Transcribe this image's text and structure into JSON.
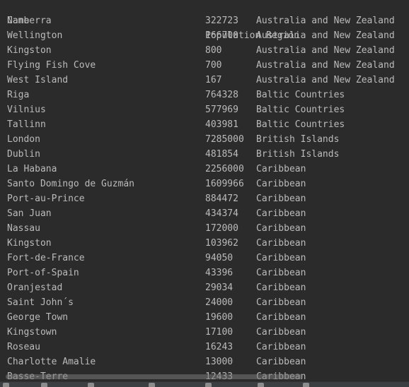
{
  "console": {
    "header": {
      "name": "Name",
      "population_region": "Population Region"
    },
    "rows": [
      {
        "name": "Canberra",
        "population": "322723",
        "region": "Australia and New Zealand"
      },
      {
        "name": "Wellington",
        "population": "166700",
        "region": "Australia and New Zealand"
      },
      {
        "name": "Kingston",
        "population": "800",
        "region": "Australia and New Zealand"
      },
      {
        "name": "Flying Fish Cove",
        "population": "700",
        "region": "Australia and New Zealand"
      },
      {
        "name": "West Island",
        "population": "167",
        "region": "Australia and New Zealand"
      },
      {
        "name": "Riga",
        "population": "764328",
        "region": "Baltic Countries"
      },
      {
        "name": "Vilnius",
        "population": "577969",
        "region": "Baltic Countries"
      },
      {
        "name": "Tallinn",
        "population": "403981",
        "region": "Baltic Countries"
      },
      {
        "name": "London",
        "population": "7285000",
        "region": "British Islands"
      },
      {
        "name": "Dublin",
        "population": "481854",
        "region": "British Islands"
      },
      {
        "name": "La Habana",
        "population": "2256000",
        "region": "Caribbean"
      },
      {
        "name": "Santo Domingo de Guzmán",
        "population": "1609966",
        "region": "Caribbean"
      },
      {
        "name": "Port-au-Prince",
        "population": "884472",
        "region": "Caribbean"
      },
      {
        "name": "San Juan",
        "population": "434374",
        "region": "Caribbean"
      },
      {
        "name": "Nassau",
        "population": "172000",
        "region": "Caribbean"
      },
      {
        "name": "Kingston",
        "population": "103962",
        "region": "Caribbean"
      },
      {
        "name": "Fort-de-France",
        "population": "94050",
        "region": "Caribbean"
      },
      {
        "name": "Port-of-Spain",
        "population": "43396",
        "region": "Caribbean"
      },
      {
        "name": "Oranjestad",
        "population": "29034",
        "region": "Caribbean"
      },
      {
        "name": "Saint John´s",
        "population": "24000",
        "region": "Caribbean"
      },
      {
        "name": "George Town",
        "population": "19600",
        "region": "Caribbean"
      },
      {
        "name": "Kingstown",
        "population": "17100",
        "region": "Caribbean"
      },
      {
        "name": "Roseau",
        "population": "16243",
        "region": "Caribbean"
      },
      {
        "name": "Charlotte Amalie",
        "population": "13000",
        "region": "Caribbean"
      },
      {
        "name": "Basse-Terre",
        "population": "12433",
        "region": "Caribbean"
      }
    ]
  },
  "colors": {
    "background": "#2b2b2b",
    "text": "#bbbbbb",
    "toolbar": "#3c3f41"
  },
  "bottom_toolbar": {
    "icons": [
      "run-icon",
      "todo-icon",
      "problems-icon",
      "terminal-icon",
      "profiler-icon",
      "build-icon",
      "services-icon"
    ]
  }
}
